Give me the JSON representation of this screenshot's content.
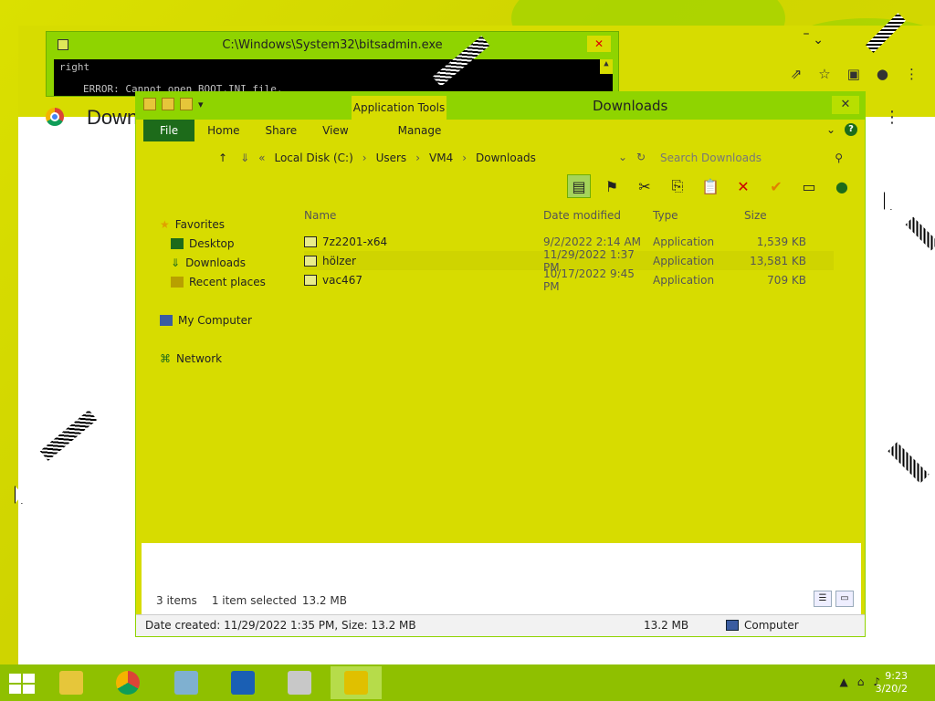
{
  "chrome": {
    "heading": "Down",
    "min": "–",
    "chevron": "⌄",
    "kebab": "⋮",
    "icons": [
      "share-icon",
      "star-icon",
      "sidebar-icon",
      "profile-icon",
      "kebab-icon"
    ]
  },
  "console": {
    "title": "C:\\Windows\\System32\\bitsadmin.exe",
    "line1": "right",
    "line2": "ERROR: Cannot open BOOT.INI file.",
    "close": "✕"
  },
  "explorer": {
    "app_tools": "Application Tools",
    "title": "Downloads",
    "close": "✕",
    "tabs": [
      "File",
      "Home",
      "Share",
      "View",
      "Manage"
    ],
    "address": {
      "segments": [
        "Local Disk (C:)",
        "Users",
        "VM4",
        "Downloads"
      ],
      "prefix": "«"
    },
    "search_placeholder": "Search Downloads",
    "nav": {
      "favorites": "Favorites",
      "favorites_items": [
        "Desktop",
        "Downloads",
        "Recent places"
      ],
      "my_computer": "My Computer",
      "network": "Network"
    },
    "columns": {
      "name": "Name",
      "date": "Date modified",
      "type": "Type",
      "size": "Size"
    },
    "files": [
      {
        "name": "7z2201-x64",
        "date": "9/2/2022 2:14 AM",
        "type": "Application",
        "size": "1,539 KB"
      },
      {
        "name": "hölzer",
        "date": "11/29/2022 1:37 PM",
        "type": "Application",
        "size": "13,581 KB"
      },
      {
        "name": "vac467",
        "date": "10/17/2022 9:45 PM",
        "type": "Application",
        "size": "709 KB"
      }
    ],
    "status": {
      "items": "3 items",
      "selected": "1 item selected",
      "selected_size": "13.2 MB"
    },
    "details": {
      "left": "Date created: 11/29/2022 1:35 PM, Size: 13.2 MB",
      "size": "13.2 MB",
      "location": "Computer"
    }
  },
  "taskbar": {
    "apps": [
      "file-explorer",
      "chrome",
      "media-player",
      "defender",
      "calculator",
      "keys-app"
    ],
    "clock_time": "9:23",
    "clock_date": "3/20/2"
  }
}
